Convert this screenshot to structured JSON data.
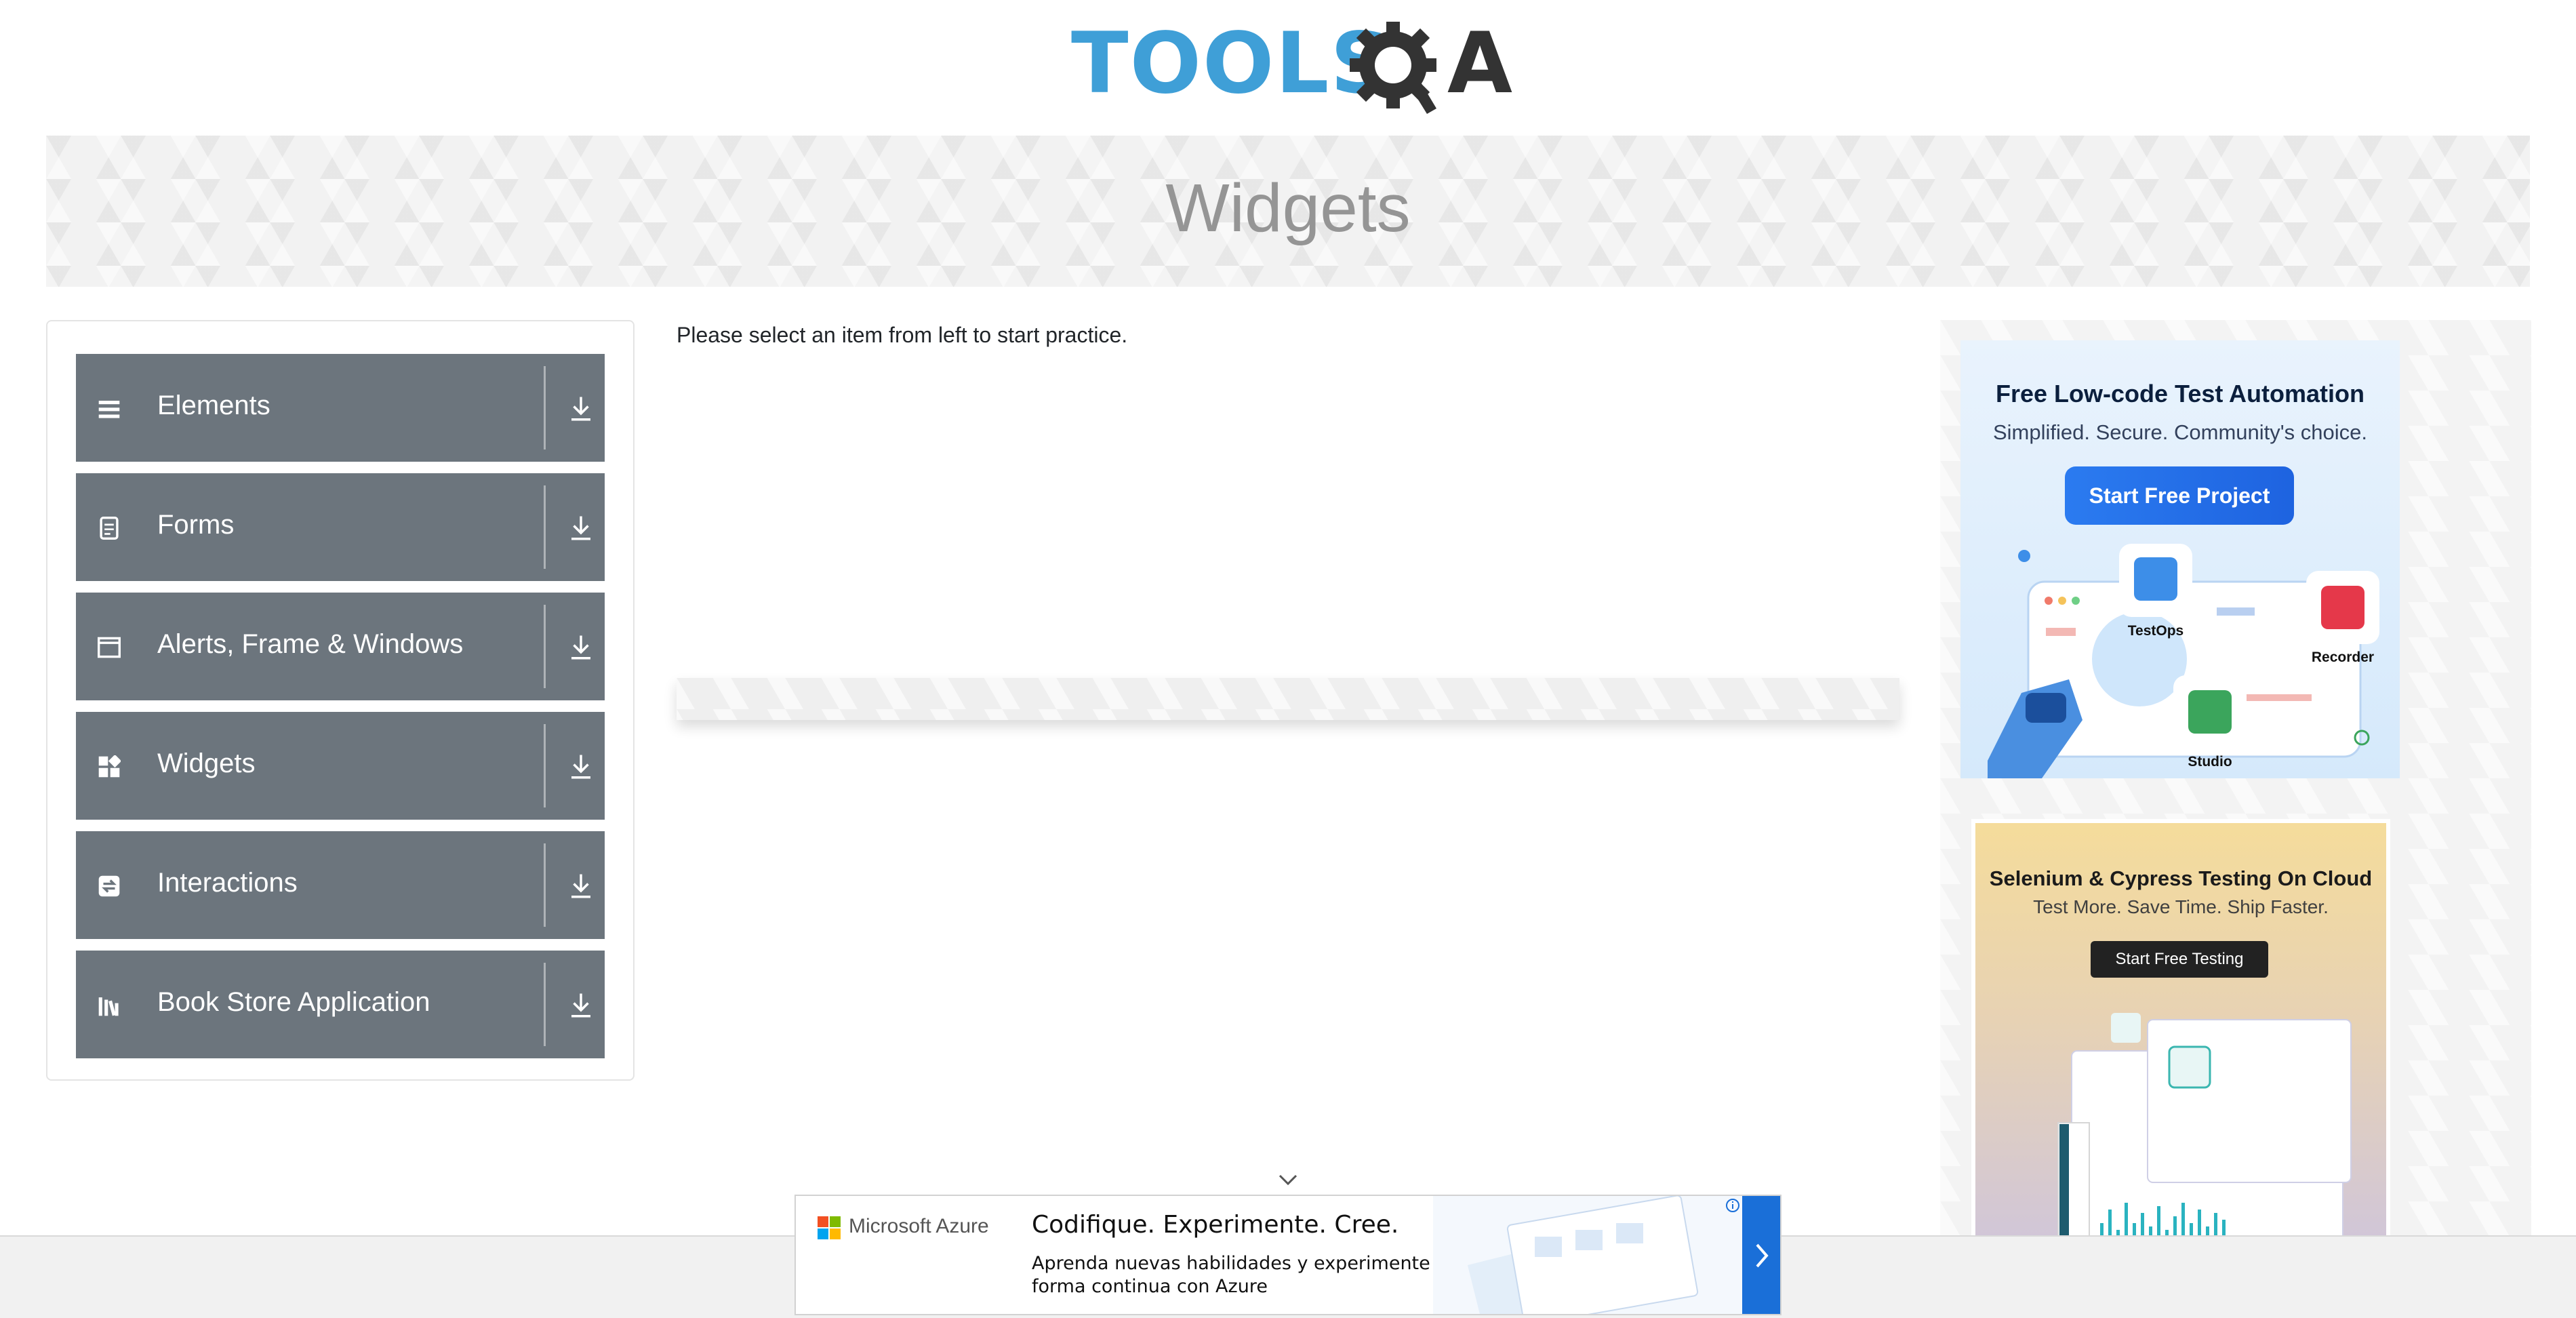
{
  "header": {
    "logo_text_tools": "TOOLS",
    "logo_text_qa": "QA"
  },
  "banner": {
    "title": "Widgets"
  },
  "sidebar": {
    "items": [
      {
        "label": "Elements",
        "icon": "list-icon"
      },
      {
        "label": "Forms",
        "icon": "form-icon"
      },
      {
        "label": "Alerts, Frame & Windows",
        "icon": "window-icon"
      },
      {
        "label": "Widgets",
        "icon": "widgets-icon"
      },
      {
        "label": "Interactions",
        "icon": "interactions-icon"
      },
      {
        "label": "Book Store Application",
        "icon": "books-icon"
      }
    ]
  },
  "main": {
    "intro": "Please select an item from left to start practice."
  },
  "ads": {
    "katalon": {
      "title": "Free Low-code Test Automation",
      "subtitle": "Simplified. Secure. Community's choice.",
      "button": "Start Free Project",
      "labels": [
        "TestOps",
        "Recorder",
        "Studio"
      ]
    },
    "lambdatest": {
      "title": "Selenium & Cypress Testing On Cloud",
      "subtitle": "Test More. Save Time. Ship Faster.",
      "button": "Start Free Testing"
    },
    "azure": {
      "brand": "Microsoft Azure",
      "headline": "Codifique. Experimente. Cree.",
      "desc1": "Aprenda nuevas habilidades y experimente de",
      "desc2": "forma continua con Azure"
    }
  },
  "colors": {
    "menu_bg": "#6c757d",
    "logo_blue": "#3f9fd7",
    "logo_dark": "#333333",
    "banner_title": "#959595"
  }
}
